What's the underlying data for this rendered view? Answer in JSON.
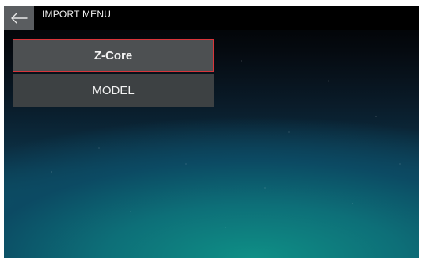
{
  "header": {
    "back_icon": "arrow-left-icon",
    "title": "IMPORT MENU"
  },
  "menu": {
    "items": [
      {
        "label": "Z-Core",
        "selected": true
      },
      {
        "label": "MODEL",
        "selected": false
      }
    ]
  },
  "colors": {
    "selected_border": "#d8353a",
    "button_bg": "#3d4143",
    "back_button_bg": "#5a5d60"
  }
}
